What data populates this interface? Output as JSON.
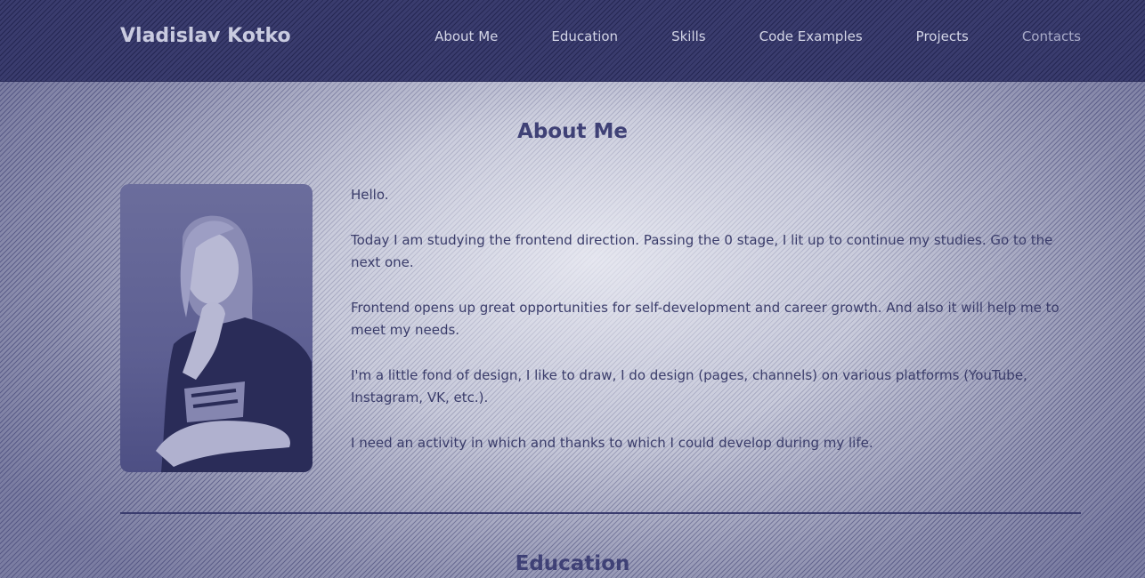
{
  "header": {
    "logo": "Vladislav Kotko",
    "nav": [
      {
        "label": "About Me"
      },
      {
        "label": "Education"
      },
      {
        "label": "Skills"
      },
      {
        "label": "Code Examples"
      },
      {
        "label": "Projects"
      },
      {
        "label": "Contacts"
      }
    ]
  },
  "about": {
    "title": "About Me",
    "paragraphs": [
      "Hello.",
      "Today I am studying the frontend direction. Passing the 0 stage, I lit up to continue my studies. Go to the next one.",
      "Frontend opens up great opportunities for self-development and career growth. And also it will help me to meet my needs.",
      "I'm a little fond of design, I like to draw, I do design (pages, channels) on various platforms (YouTube, Instagram, VK, etc.).",
      "I need an activity in which and thanks to which I could develop during my life."
    ]
  },
  "education": {
    "title": "Education"
  },
  "colors": {
    "header_bg": "#3a3c6e",
    "accent": "#3f4176",
    "text": "#3a3c6a",
    "page_bg": "#b7b9cc"
  }
}
